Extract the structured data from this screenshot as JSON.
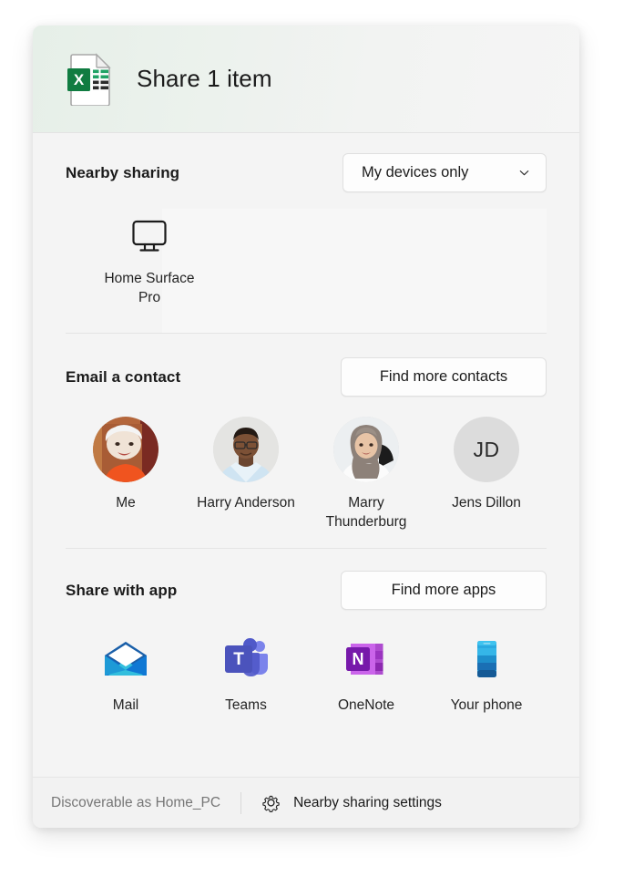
{
  "dialog": {
    "header": {
      "title": "Share 1 item",
      "file_icon": "excel-file-icon"
    },
    "nearby_sharing": {
      "title": "Nearby sharing",
      "dropdown": {
        "name": "nearby-sharing-scope-dropdown",
        "value": "My devices only",
        "chevron": "chevron-down-icon"
      },
      "devices": [
        {
          "label": "Home Surface Pro",
          "icon": "monitor-icon"
        }
      ]
    },
    "email_contact": {
      "title": "Email a contact",
      "action_button": "Find more contacts",
      "contacts": [
        {
          "label": "Me",
          "avatar_type": "photo",
          "avatar_name": "avatar-me"
        },
        {
          "label": "Harry Anderson",
          "avatar_type": "photo",
          "avatar_name": "avatar-harry-anderson"
        },
        {
          "label": "Marry Thunderburg",
          "avatar_type": "photo",
          "avatar_name": "avatar-marry-thunderburg"
        },
        {
          "label": "Jens Dillon",
          "avatar_type": "initials",
          "initials": "JD",
          "avatar_name": "avatar-jens-dillon"
        }
      ]
    },
    "share_with_app": {
      "title": "Share with app",
      "action_button": "Find more apps",
      "apps": [
        {
          "label": "Mail",
          "icon": "mail-app-icon"
        },
        {
          "label": "Teams",
          "icon": "teams-app-icon"
        },
        {
          "label": "OneNote",
          "icon": "onenote-app-icon"
        },
        {
          "label": "Your phone",
          "icon": "your-phone-app-icon"
        }
      ]
    },
    "footer": {
      "discoverable_text": "Discoverable as Home_PC",
      "settings_label": "Nearby sharing settings",
      "settings_icon": "gear-icon"
    }
  },
  "colors": {
    "excel_green": "#21a366",
    "excel_green_dark": "#107c41",
    "teams_purple": "#5059c9",
    "teams_purple_light": "#7b83eb",
    "onenote_purple": "#7719aa",
    "onenote_magenta": "#ca64ea",
    "mail_blue": "#0f78d4",
    "mail_blue_light": "#32bedd",
    "phone_blue": "#1f6eb4",
    "dialog_bg": "#f4f4f4",
    "header_tint": "#e6efe8"
  }
}
